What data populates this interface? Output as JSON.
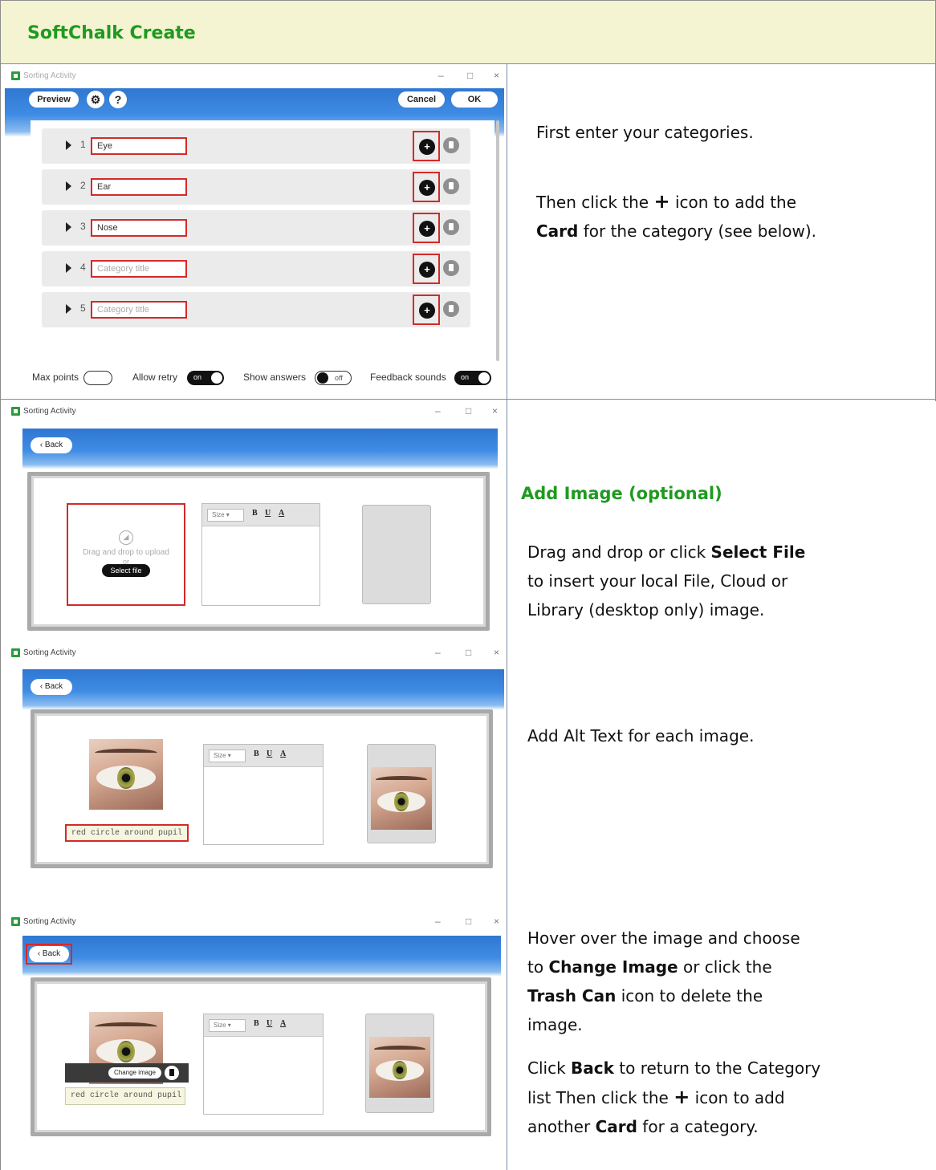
{
  "header": {
    "title": "SoftChalk Create"
  },
  "window": {
    "name_faded": "Sorting Activity",
    "name": "Sorting Activity",
    "min": "–",
    "max": "□",
    "close": "×"
  },
  "toolbar": {
    "preview": "Preview",
    "settings_icon": "⚙",
    "help_icon": "?",
    "cancel": "Cancel",
    "ok": "OK",
    "back": "‹ Back"
  },
  "categories": [
    {
      "num": "1",
      "title": "Eye",
      "placeholder": false
    },
    {
      "num": "2",
      "title": "Ear",
      "placeholder": false
    },
    {
      "num": "3",
      "title": "Nose",
      "placeholder": false
    },
    {
      "num": "4",
      "title": "Category title",
      "placeholder": true
    },
    {
      "num": "5",
      "title": "Category title",
      "placeholder": true
    }
  ],
  "plus_symbol": "+",
  "options": {
    "max_points": "Max points",
    "allow_retry": "Allow retry",
    "allow_retry_state": "on",
    "show_answers": "Show answers",
    "show_answers_state": "off",
    "feedback_sounds": "Feedback sounds",
    "feedback_sounds_state": "on"
  },
  "editor": {
    "size": "Size",
    "bold": "B",
    "underline": "U",
    "color": "A",
    "dropdown_arrow": "▾"
  },
  "upload": {
    "drag_text": "Drag and drop to upload",
    "or": "or",
    "select_file": "Select file",
    "image_icon": "image-upload-icon"
  },
  "image_overlay": {
    "change_image": "Change image",
    "trash_icon": "trash-icon"
  },
  "alt_text": "red circle around pupil",
  "right": {
    "s1_line1": "First enter your categories.",
    "s1_line2_pre": "Then click the",
    "s1_line2_post": "icon to add the",
    "s1_card": "Card",
    "s1_line3_post": "for the category (see below).",
    "s2_heading": "Add Image (optional)",
    "s2_line1_pre": "Drag and drop or click",
    "s2_select": "Select File",
    "s2_line2": "to insert your local File, Cloud or",
    "s2_line3": "Library (desktop only) image.",
    "s3_line1": "Add Alt Text for each image.",
    "s4_line1": "Hover over the image and choose",
    "s4_line2_pre": "to",
    "s4_change": "Change Image",
    "s4_line2_post": "or click the",
    "s4_trash": "Trash Can",
    "s4_line3_post": "icon to delete the",
    "s4_line4": "image.",
    "s5_line1_pre": "Click",
    "s5_back": "Back",
    "s5_line1_post": "to return to the Category",
    "s5_line2_pre": "list Then click the",
    "s5_line2_post": "icon to add",
    "s5_line3_pre": "another",
    "s5_card": "Card",
    "s5_line3_post": "for a category."
  }
}
